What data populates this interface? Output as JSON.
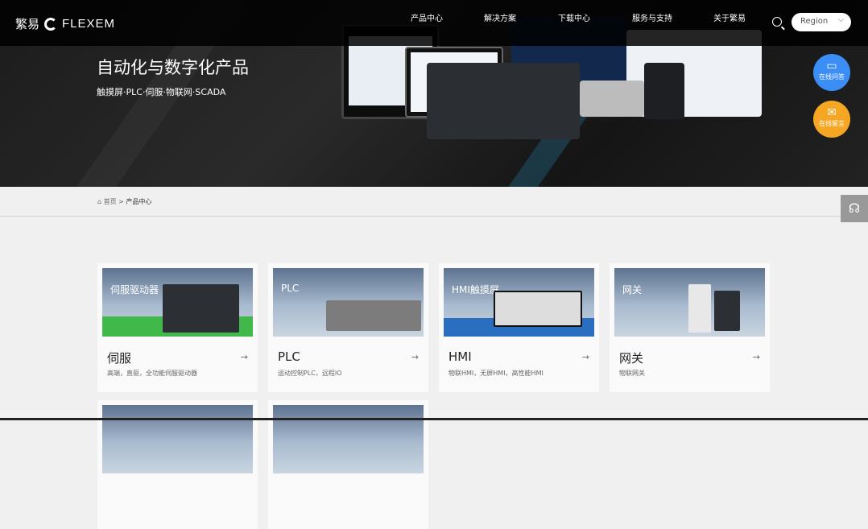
{
  "header": {
    "logo_cn": "繁易",
    "logo_en": "FLEXEM",
    "nav": [
      "产品中心",
      "解决方案",
      "下载中心",
      "服务与支持",
      "关于繁易"
    ],
    "region": "Region"
  },
  "hero": {
    "title": "自动化与数字化产品",
    "subtitle": "触摸屏·PLC·伺服·物联网·SCADA"
  },
  "float": [
    {
      "label": "在线问答",
      "color": "#3a8ef6"
    },
    {
      "label": "在线留言",
      "color": "#f5a623"
    }
  ],
  "breadcrumb": {
    "home": "首页",
    "sep": ">",
    "current": "产品中心"
  },
  "cards": [
    {
      "tag": "伺服驱动器",
      "title": "伺服",
      "desc": "高端，直驱，全功能伺服驱动器"
    },
    {
      "tag": "PLC",
      "title": "PLC",
      "desc": "运动控制PLC，远程IO"
    },
    {
      "tag": "HMI触摸屏",
      "title": "HMI",
      "desc": "物联HMI，无屏HMI，高性能HMI"
    },
    {
      "tag": "网关",
      "title": "网关",
      "desc": "物联网关"
    }
  ],
  "arrow": "→"
}
